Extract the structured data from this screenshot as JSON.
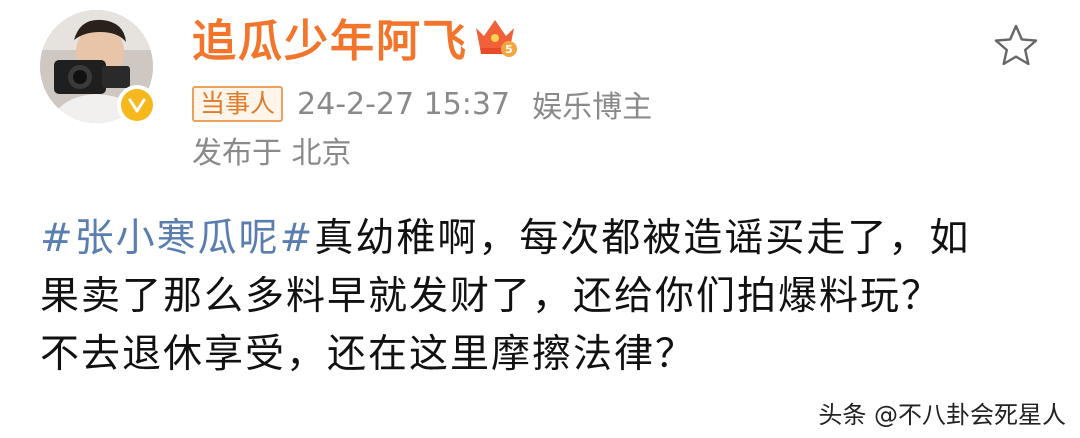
{
  "post": {
    "username": "追瓜少年阿飞",
    "role_badge": "当事人",
    "timestamp": "24-2-27 15:37",
    "user_role": "娱乐博主",
    "location": "发布于 北京",
    "content": {
      "hashtag": "#张小寒瓜呢#",
      "line1_rest": "真幼稚啊，每次都被造谣买走了，如",
      "line2": "果卖了那么多料早就发财了，还给你们拍爆料玩？",
      "line3": "不去退休享受，还在这里摩擦法律？"
    }
  },
  "icons": {
    "avatar": "avatar",
    "verified": "verified-badge-icon",
    "crown": "crown-icon",
    "favorite": "star-icon"
  },
  "colors": {
    "username": "#f2752b",
    "hashtag": "#5a7eb0",
    "meta": "#8a8a8a",
    "verified": "#f6b81c"
  },
  "watermark": "头条 @不八卦会死星人"
}
